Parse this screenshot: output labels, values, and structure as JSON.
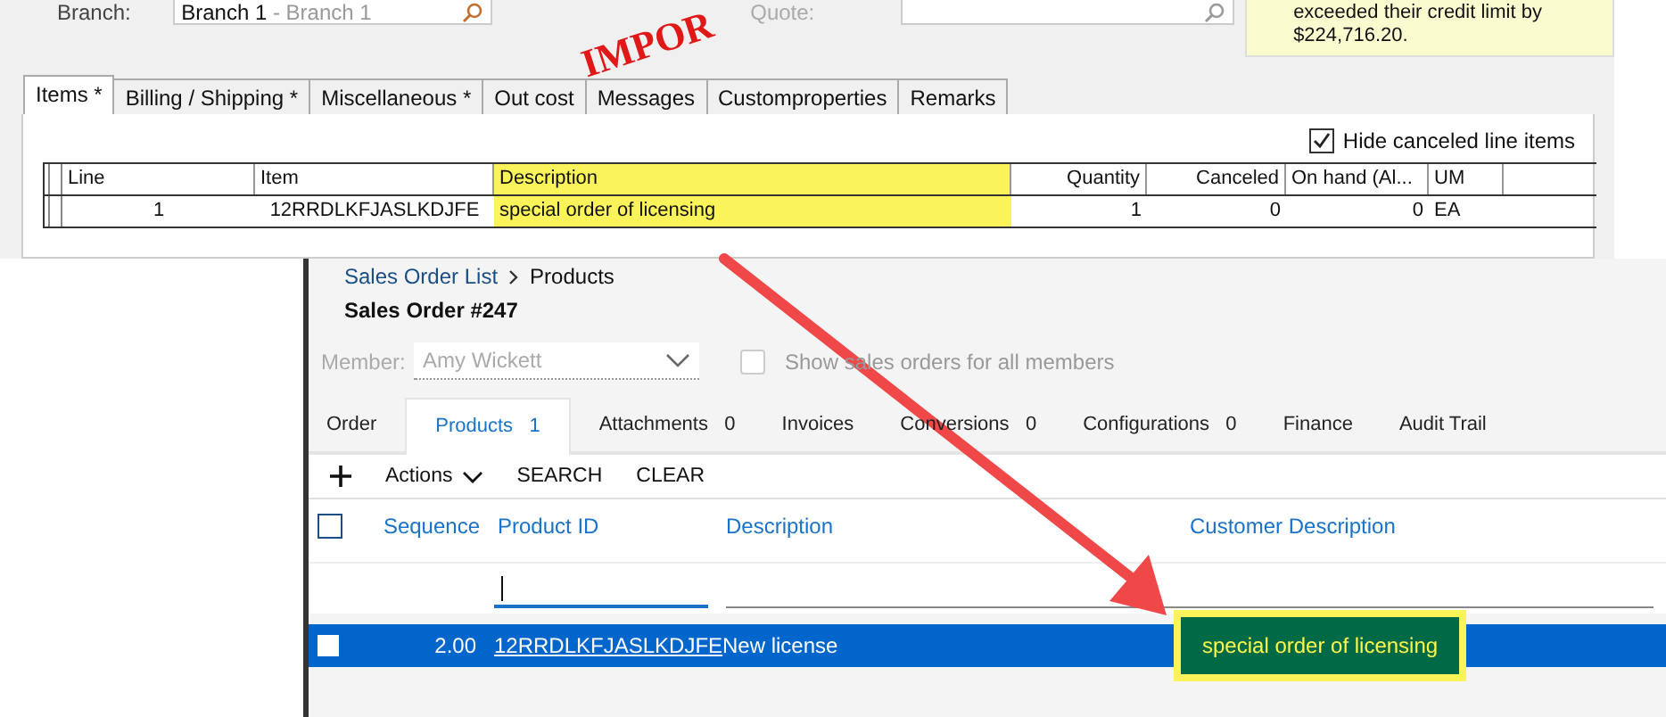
{
  "legacy_window": {
    "branch_label": "Branch:",
    "branch_value": "Branch 1",
    "branch_desc": " - Branch 1",
    "stamp_text": "IMPOR",
    "quote_label": "Quote:",
    "credit_note": [
      "exceeded their credit limit by",
      "$224,716.20."
    ],
    "tabs": [
      {
        "label": "Items *",
        "selected": true
      },
      {
        "label": "Billing / Shipping  *",
        "selected": false
      },
      {
        "label": "Miscellaneous *",
        "selected": false
      },
      {
        "label": "Out cost",
        "selected": false
      },
      {
        "label": "Messages",
        "selected": false
      },
      {
        "label": "Customproperties",
        "selected": false
      },
      {
        "label": "Remarks",
        "selected": false
      }
    ],
    "hide_canceled": {
      "label": "Hide canceled line items",
      "checked": true
    },
    "grid": {
      "columns": [
        {
          "label": "Line",
          "highlighted": false
        },
        {
          "label": "Item",
          "highlighted": false
        },
        {
          "label": "Description",
          "highlighted": true
        },
        {
          "label": "Quantity",
          "highlighted": false
        },
        {
          "label": "Canceled",
          "highlighted": false
        },
        {
          "label": "On hand (Al...",
          "highlighted": false
        },
        {
          "label": "UM",
          "highlighted": false
        }
      ],
      "rows": [
        [
          "1",
          "12RRDLKFJASLKDJFE",
          "special order of licensing",
          "1",
          "0",
          "0",
          "EA"
        ]
      ]
    }
  },
  "web_app": {
    "breadcrumb": [
      {
        "label": "Sales Order List",
        "kind": "link"
      },
      {
        "label": "Products",
        "kind": "current"
      }
    ],
    "title": "Sales Order #247",
    "member": {
      "label": "Member:",
      "value": "Amy Wickett",
      "disabled": true
    },
    "show_all": {
      "label": "Show sales orders for all members",
      "checked": false
    },
    "tabs": [
      {
        "label": "Order",
        "selected": false
      },
      {
        "label": "Products",
        "count": "1",
        "selected": true
      },
      {
        "label": "Attachments",
        "count": "0",
        "selected": false
      },
      {
        "label": "Invoices",
        "selected": false
      },
      {
        "label": "Conversions",
        "count": "0",
        "selected": false
      },
      {
        "label": "Configurations",
        "count": "0",
        "selected": false
      },
      {
        "label": "Finance",
        "selected": false
      },
      {
        "label": "Audit Trail",
        "selected": false
      }
    ],
    "toolbar": {
      "actions": "Actions",
      "search": "SEARCH",
      "clear": "CLEAR"
    },
    "table": {
      "all_selected": false,
      "columns": [
        "Sequence",
        "Product ID",
        "Description",
        "Customer Description"
      ],
      "rows": [
        {
          "selected": true,
          "sequence": "2.00",
          "product_id": "12RRDLKFJASLKDJFE",
          "description": "New license",
          "customer_description": "special order of licensing",
          "customer_description_highlighted": true
        }
      ]
    }
  }
}
